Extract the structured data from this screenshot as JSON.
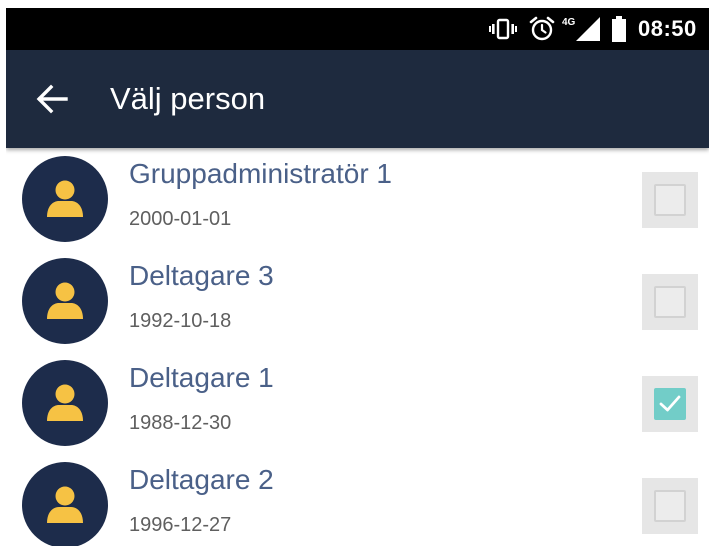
{
  "status_bar": {
    "time": "08:50",
    "network": "4G",
    "icons": [
      "vibrate-icon",
      "alarm-icon",
      "signal-icon",
      "battery-icon"
    ]
  },
  "app_bar": {
    "title": "Välj person",
    "back_icon": "back-arrow-icon"
  },
  "colors": {
    "status_bar": "#000000",
    "app_bar": "#1e2a3e",
    "avatar_bg": "#1d2c4b",
    "avatar_icon": "#f6c244",
    "name_text": "#4a6088",
    "checkbox_checked": "#72cdc8"
  },
  "persons": [
    {
      "name": "Gruppadministratör 1",
      "date": "2000-01-01",
      "checked": false
    },
    {
      "name": "Deltagare 3",
      "date": "1992-10-18",
      "checked": false
    },
    {
      "name": "Deltagare 1",
      "date": "1988-12-30",
      "checked": true
    },
    {
      "name": "Deltagare 2",
      "date": "1996-12-27",
      "checked": false
    }
  ]
}
